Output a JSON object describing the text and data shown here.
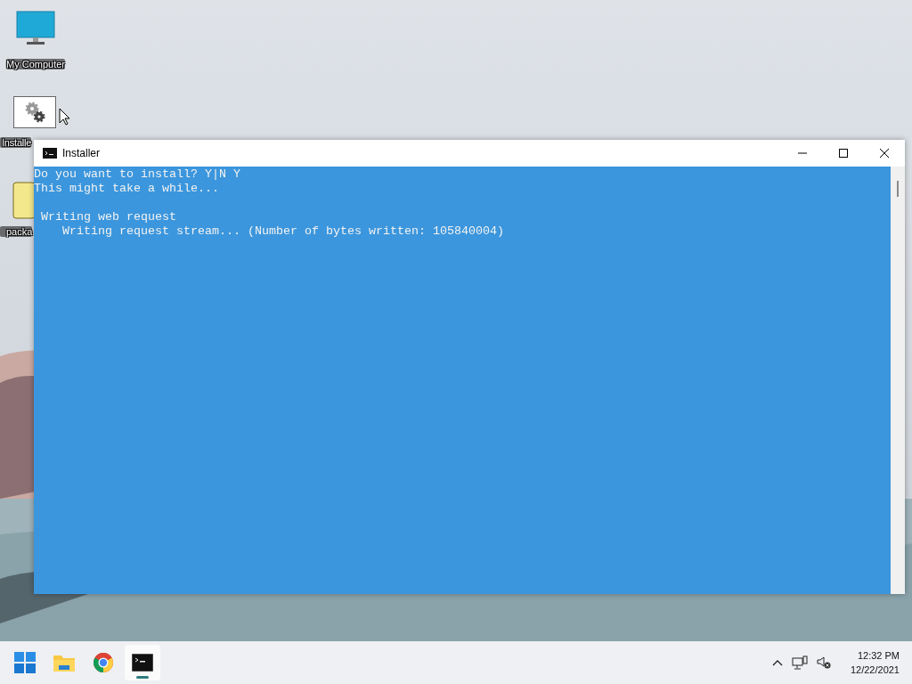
{
  "desktop": {
    "icons": [
      {
        "label": "My Computer",
        "kind": "monitor"
      },
      {
        "label": "Installe",
        "kind": "app"
      },
      {
        "label": "packa",
        "kind": "folder"
      }
    ]
  },
  "window": {
    "title": "Installer",
    "blocks": [
      {
        "lines": [
          "Do you want to install? Y|N Y",
          "This might take a while..."
        ]
      },
      {
        "lines": [
          " Writing web request",
          "    Writing request stream... (Number of bytes written: 105840004)"
        ]
      }
    ]
  },
  "taskbar": {
    "apps": [
      {
        "kind": "start",
        "selected": false
      },
      {
        "kind": "folder",
        "selected": false
      },
      {
        "kind": "browser",
        "selected": false
      },
      {
        "kind": "console",
        "selected": true
      }
    ],
    "clock": {
      "time": "12:32 PM",
      "date": "12/22/2021"
    }
  }
}
